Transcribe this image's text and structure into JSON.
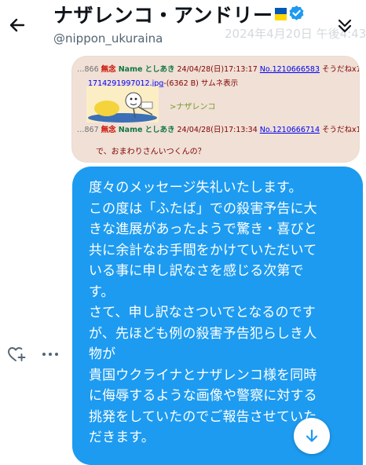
{
  "header": {
    "display_name": "ナザレンコ・アンドリー",
    "handle": "@nippon_ukuraina",
    "timestamp": "2024年4月20日 午後4:43",
    "flag_colors": [
      "#0057b7",
      "#ffd700"
    ],
    "back_icon": "arrow-left-icon",
    "collapse_icon": "chevrons-down-icon"
  },
  "quoted_image": {
    "post1": {
      "num": "866",
      "mark": "無念",
      "label_name": "Name",
      "name": "としあき",
      "datetime": "24/04/28(日)17:13:17",
      "no": "No.1210666583",
      "sodane": "そうだねx1",
      "file_link": "1714291997012.jpg",
      "file_info": "-(6362 B) サムネ表示",
      "quote": ">ナザレンコ"
    },
    "post2": {
      "num": "867",
      "mark": "無念",
      "label_name": "Name",
      "name": "としあき",
      "datetime": "24/04/28(日)17:13:34",
      "no": "No.1210666714",
      "sodane": "そうだねx1",
      "body": "で、おまわりさんいつくんの？"
    }
  },
  "message": {
    "lines": [
      "度々のメッセージ失礼いたします。",
      "この度は「ふたば」での殺害予告に大",
      "きな進展があったようで驚き・喜びと",
      "共に余計なお手間をかけていただいて",
      "いる事に申し訳なさを感じる次第で",
      "す。",
      "さて、申し訳なさついでとなるのです",
      "が、先ほども例の殺害予告犯らしき人",
      "物が",
      "貴国ウクライナとナザレンコ様を同時",
      "に侮辱するような画像や警察に対する",
      "挑発をしていたのでご報告させていた",
      "だきます。"
    ],
    "bubble_color": "#1d9bf0"
  },
  "actions": {
    "react_icon": "heart-plus-icon",
    "more_icon": "ellipsis-icon",
    "scroll_down_icon": "arrow-down-icon"
  }
}
